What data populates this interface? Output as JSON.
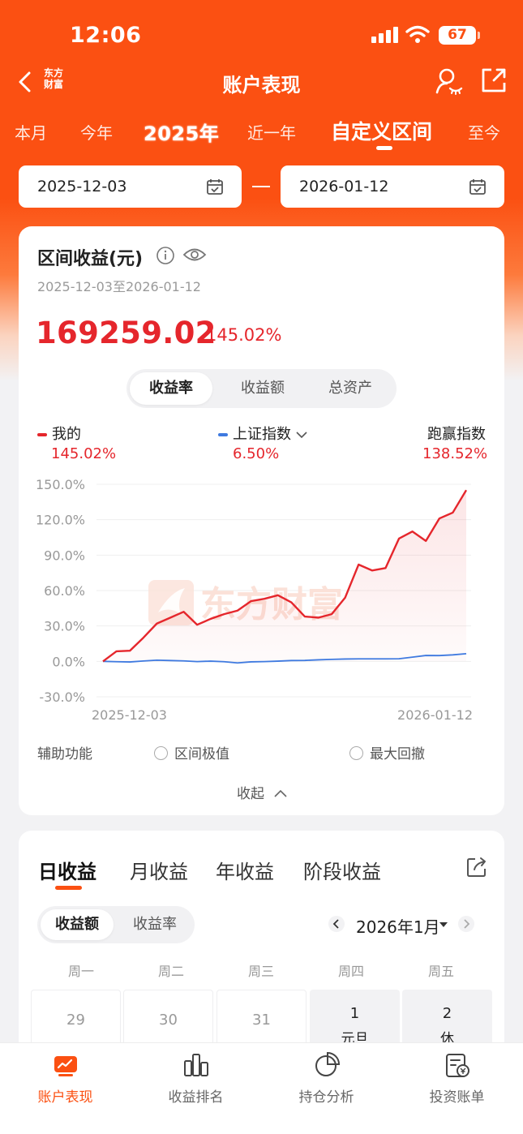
{
  "status_bar": {
    "time": "12:06",
    "battery": "67"
  },
  "nav": {
    "title": "账户表现",
    "logo_line1": "东方",
    "logo_line2": "财富"
  },
  "period_tabs": [
    "本月",
    "今年",
    "2025年",
    "近一年",
    "自定义区间",
    "至今"
  ],
  "period_active": "自定义区间",
  "date_range": {
    "start": "2025-12-03",
    "end": "2026-01-12"
  },
  "summary": {
    "title": "区间收益(元)",
    "range": "2025-12-03至2026-01-12",
    "amount": "169259.02",
    "rate": "145.02%"
  },
  "chart_tabs": [
    "收益率",
    "收益额",
    "总资产"
  ],
  "chart_tab_active": "收益率",
  "legend": {
    "mine_label": "我的",
    "mine_value": "145.02%",
    "index_label": "上证指数",
    "index_value": "6.50%",
    "beat_label": "跑赢指数",
    "beat_value": "138.52%"
  },
  "watermark": "东方财富",
  "colors": {
    "brand": "#fb5012",
    "mine": "#e5262c",
    "index": "#3f7ae0"
  },
  "chart_data": {
    "type": "line",
    "ylim": [
      -30,
      150
    ],
    "y_ticks": [
      "150.0%",
      "120.0%",
      "90.0%",
      "60.0%",
      "30.0%",
      "0.0%",
      "-30.0%"
    ],
    "x_tick_labels": [
      "2025-12-03",
      "2026-01-12"
    ],
    "series": [
      {
        "name": "我的",
        "values": [
          0,
          8.5,
          9,
          20,
          32,
          37,
          42,
          31,
          36,
          40,
          43,
          51,
          53,
          56,
          50,
          38,
          37,
          40,
          54,
          82,
          77,
          79,
          104,
          110,
          102,
          121,
          126,
          145
        ]
      },
      {
        "name": "上证指数",
        "values": [
          0,
          -0.3,
          -0.5,
          0.3,
          1,
          0.7,
          0.4,
          -0.2,
          0.2,
          -0.3,
          -1.3,
          -0.4,
          -0.2,
          0.2,
          0.7,
          0.8,
          1.3,
          1.7,
          2,
          2.1,
          2.1,
          2.1,
          2.2,
          3.6,
          5,
          4.9,
          5.5,
          6.5
        ]
      }
    ]
  },
  "aux": {
    "label": "辅助功能",
    "opt1": "区间极值",
    "opt2": "最大回撤",
    "collapse": "收起"
  },
  "returns_tabs": [
    "日收益",
    "月收益",
    "年收益",
    "阶段收益"
  ],
  "returns_tab_active": "日收益",
  "returns_seg": [
    "收益额",
    "收益率"
  ],
  "month": "2026年1月",
  "weekdays": [
    "周一",
    "周二",
    "周三",
    "周四",
    "周五"
  ],
  "calendar": [
    {
      "day": "29",
      "sub": ""
    },
    {
      "day": "30",
      "sub": ""
    },
    {
      "day": "31",
      "sub": ""
    },
    {
      "day": "1",
      "sub": "元旦"
    },
    {
      "day": "2",
      "sub": "休"
    }
  ],
  "bottom_nav": [
    "账户表现",
    "收益排名",
    "持仓分析",
    "投资账单"
  ]
}
